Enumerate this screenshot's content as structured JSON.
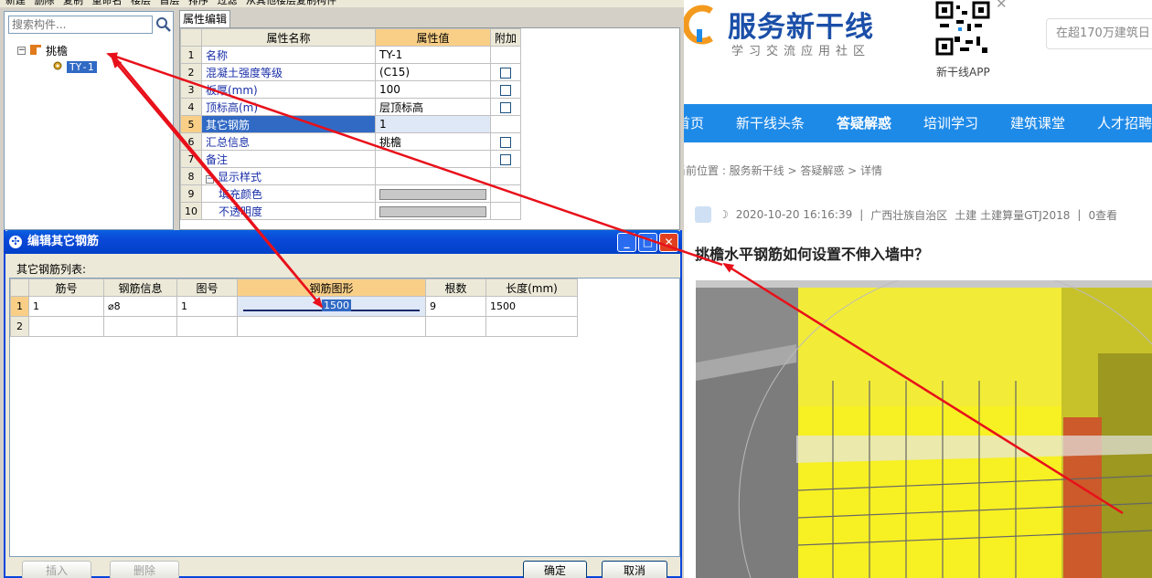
{
  "toolbar": {
    "items": [
      "新建",
      "删除",
      "复制",
      "重命名",
      "楼层",
      "首层",
      "排序",
      "过滤",
      "从其他楼层复制构件"
    ]
  },
  "left_panel": {
    "search_placeholder": "搜索构件...",
    "tree": {
      "root_label": "挑檐",
      "expander": "⊟",
      "child_label": "TY-1"
    }
  },
  "properties": {
    "tab_label": "属性编辑",
    "columns": [
      "属性名称",
      "属性值",
      "附加"
    ],
    "rows": [
      {
        "num": "1",
        "name": "名称",
        "value": "TY-1",
        "checkbox": false
      },
      {
        "num": "2",
        "name": "混凝土强度等级",
        "value": "(C15)",
        "checkbox": true
      },
      {
        "num": "3",
        "name": "板厚(mm)",
        "value": "100",
        "checkbox": true
      },
      {
        "num": "4",
        "name": "顶标高(m)",
        "value": "层顶标高",
        "checkbox": true
      },
      {
        "num": "5",
        "name": "其它钢筋",
        "value": "1",
        "checkbox": false
      },
      {
        "num": "6",
        "name": "汇总信息",
        "value": "挑檐",
        "checkbox": true
      },
      {
        "num": "7",
        "name": "备注",
        "value": "",
        "checkbox": true
      },
      {
        "num": "8",
        "name": "显示样式",
        "value": "",
        "checkbox": false
      },
      {
        "num": "9",
        "name": "填充颜色",
        "value": "",
        "checkbox": false
      },
      {
        "num": "10",
        "name": "不透明度",
        "value": "",
        "checkbox": false
      }
    ]
  },
  "dialog": {
    "title": "编辑其它钢筋",
    "list_label": "其它钢筋列表:",
    "columns": [
      "筋号",
      "钢筋信息",
      "图号",
      "钢筋图形",
      "根数",
      "长度(mm)"
    ],
    "rows": [
      {
        "num": "1",
        "bar_no": "1",
        "info": "⌀8",
        "fig_no": "1",
        "shape_value": "1500",
        "count": "9",
        "length": "1500"
      },
      {
        "num": "2",
        "bar_no": "",
        "info": "",
        "fig_no": "",
        "shape_value": "",
        "count": "",
        "length": ""
      }
    ],
    "buttons": {
      "insert": "插入",
      "delete": "删除",
      "ok": "确定",
      "cancel": "取消"
    },
    "controls": {
      "minimize": "_",
      "maximize": "□",
      "close": "✕"
    }
  },
  "website": {
    "brand": "服务新干线",
    "tagline": "学习交流应用社区",
    "app_label": "新干线APP",
    "search_placeholder": "在超170万建筑日",
    "nav": [
      "首页",
      "新干线头条",
      "答疑解惑",
      "培训学习",
      "建筑课堂",
      "人才招聘"
    ],
    "breadcrumb": "当前位置 : 服务新干线 > 答疑解惑 > 详情",
    "meta": {
      "datetime": "2020-10-20 16:16:39",
      "region": "广西壮族自治区",
      "tags": "土建 土建算量GTJ2018",
      "views": "0查看"
    },
    "title": "挑檐水平钢筋如何设置不伸入墙中？"
  },
  "colors": {
    "annotation_arrow": "#e8101a",
    "nav_bar": "#1e8ae8",
    "dialog_title": "#0a48d8",
    "highlight_header": "#f9cf87",
    "selection": "#316ac5",
    "render_yellow": "#f7f023"
  }
}
